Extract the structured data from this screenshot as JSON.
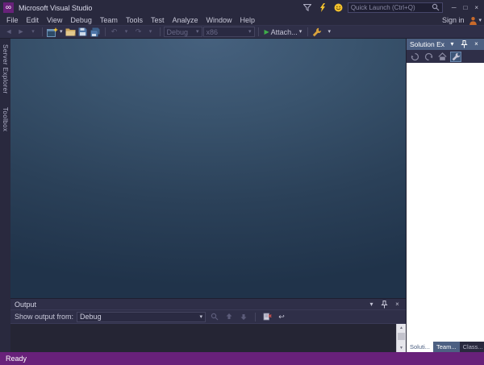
{
  "colors": {
    "chrome": "#29293e",
    "toolbar": "#2f2f48",
    "accent_purple": "#68217a",
    "panel_header_blue": "#4d6082",
    "workspace_gradient_top": "#46617e",
    "workspace_gradient_bottom": "#20334a",
    "play_green": "#3fae4a"
  },
  "icons": {
    "vs_logo": "∞",
    "dropdown": "▾",
    "close": "×",
    "minimize": "─",
    "maximize": "□",
    "back": "◄",
    "forward": "►",
    "undo": "↶",
    "redo": "↷",
    "play": "▶",
    "word_wrap": "↩",
    "scroll_up": "▲",
    "scroll_down": "▼"
  },
  "title_bar": {
    "title": "Microsoft Visual Studio",
    "quick_launch": "Quick Launch (Ctrl+Q)"
  },
  "menu": {
    "items": [
      "File",
      "Edit",
      "View",
      "Debug",
      "Team",
      "Tools",
      "Test",
      "Analyze",
      "Window",
      "Help"
    ],
    "sign_in": "Sign in"
  },
  "toolbar": {
    "debug_config": "Debug",
    "platform": "x86",
    "attach": "Attach..."
  },
  "side_tabs": {
    "server_explorer": "Server Explorer",
    "toolbox": "Toolbox"
  },
  "output": {
    "title": "Output",
    "show_from_label": "Show output from:",
    "source": "Debug"
  },
  "solution_explorer": {
    "title": "Solution Explorer",
    "tabs": [
      "Soluti...",
      "Team...",
      "Class..."
    ]
  },
  "status": {
    "text": "Ready"
  }
}
